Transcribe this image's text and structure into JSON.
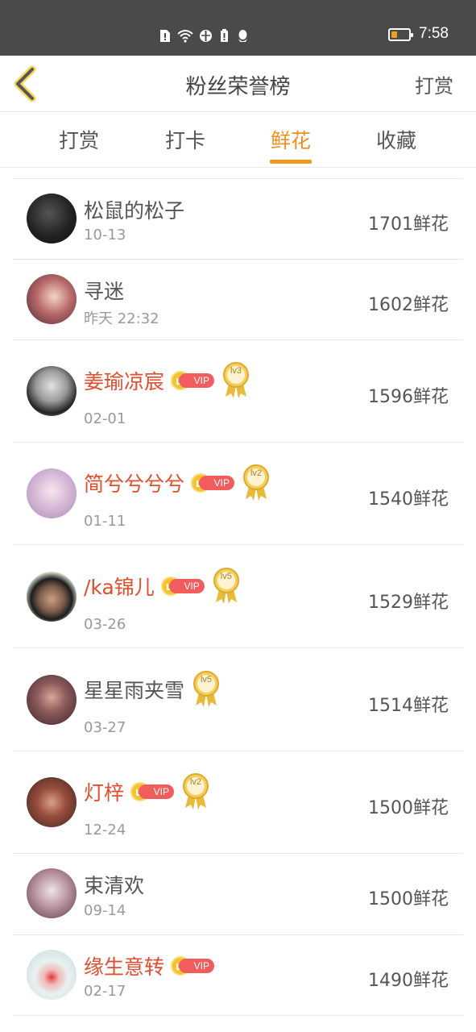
{
  "status_bar": {
    "time": "7:58",
    "battery_level": 0.3,
    "battery_color": "#f0a020"
  },
  "header": {
    "title": "粉丝荣誉榜",
    "action": "打赏"
  },
  "tabs": [
    {
      "label": "打赏",
      "active": false
    },
    {
      "label": "打卡",
      "active": false
    },
    {
      "label": "鲜花",
      "active": true
    },
    {
      "label": "收藏",
      "active": false
    }
  ],
  "colors": {
    "accent": "#ef8f1f",
    "vip_name": "#e04e2e",
    "vip_pill": "#f25c5c"
  },
  "fans": [
    {
      "name": "松鼠的松子",
      "date": "10-13",
      "amount": "1701鲜花",
      "vip": false,
      "level": null
    },
    {
      "name": "寻迷",
      "date": "昨天 22:32",
      "amount": "1602鲜花",
      "vip": false,
      "level": null
    },
    {
      "name": "姜瑜凉宸",
      "date": "02-01",
      "amount": "1596鲜花",
      "vip": true,
      "vip_label": "VIP",
      "level": "lv3"
    },
    {
      "name": "简兮兮兮兮",
      "date": "01-11",
      "amount": "1540鲜花",
      "vip": true,
      "vip_label": "VIP",
      "level": "lv2"
    },
    {
      "name": "/ka锦儿",
      "date": "03-26",
      "amount": "1529鲜花",
      "vip": true,
      "vip_label": "VIP",
      "level": "lv5"
    },
    {
      "name": "星星雨夹雪",
      "date": "03-27",
      "amount": "1514鲜花",
      "vip": false,
      "level": "lv5"
    },
    {
      "name": "灯梓",
      "date": "12-24",
      "amount": "1500鲜花",
      "vip": true,
      "vip_label": "VIP",
      "level": "lv2"
    },
    {
      "name": "束清欢",
      "date": "09-14",
      "amount": "1500鲜花",
      "vip": false,
      "level": null
    },
    {
      "name": "缘生意转",
      "date": "02-17",
      "amount": "1490鲜花",
      "vip": true,
      "vip_label": "VIP",
      "level": null
    }
  ]
}
